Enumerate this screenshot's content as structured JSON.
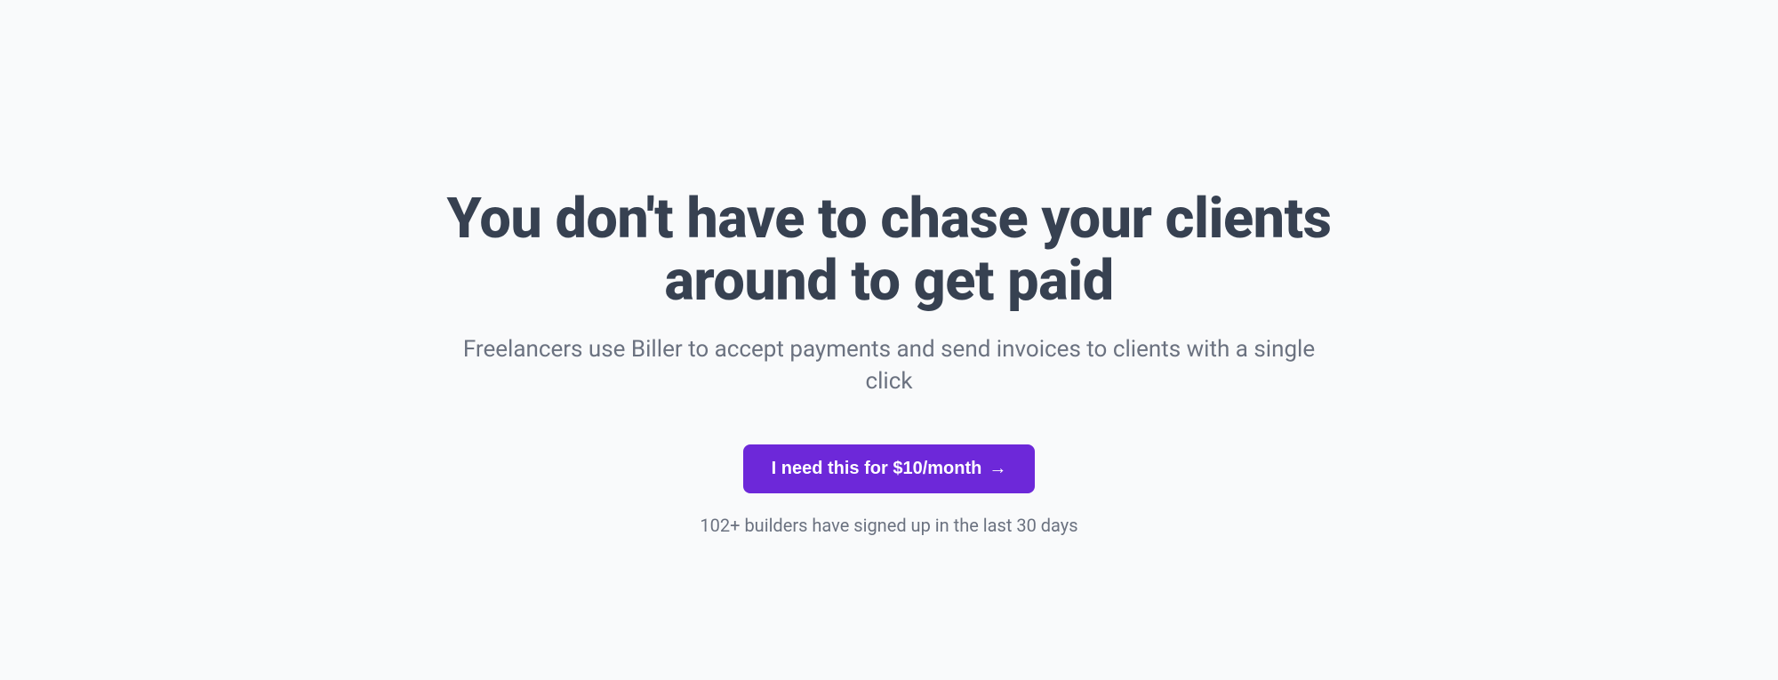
{
  "hero": {
    "headline": "You don't have to chase your clients around to get paid",
    "subheadline": "Freelancers use Biller to accept payments and send invoices to clients with a single click",
    "cta_label": "I need this for $10/month",
    "cta_arrow": "→",
    "social_proof": "102+ builders have signed up in the last 30 days"
  }
}
